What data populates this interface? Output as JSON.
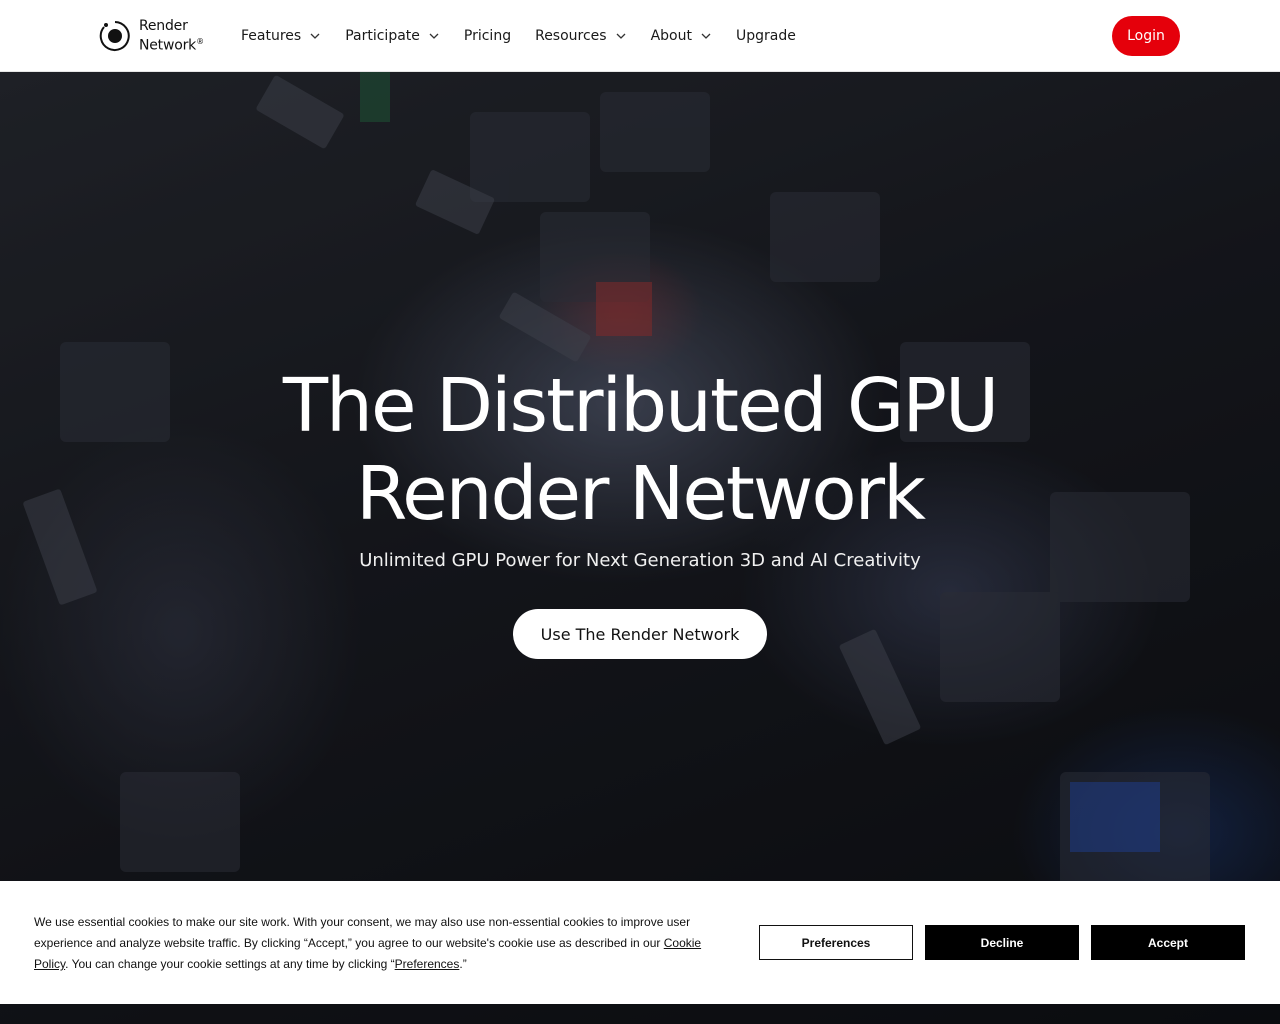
{
  "header": {
    "logo_line1": "Render",
    "logo_line2": "Network",
    "logo_reg": "®",
    "nav": [
      {
        "label": "Features",
        "has_dropdown": true
      },
      {
        "label": "Participate",
        "has_dropdown": true
      },
      {
        "label": "Pricing",
        "has_dropdown": false
      },
      {
        "label": "Resources",
        "has_dropdown": true
      },
      {
        "label": "About",
        "has_dropdown": true
      },
      {
        "label": "Upgrade",
        "has_dropdown": false
      }
    ],
    "login_label": "Login"
  },
  "hero": {
    "title_line1": "The Distributed GPU",
    "title_line2": "Render Network",
    "subtitle": "Unlimited GPU Power for Next Generation 3D and AI Creativity",
    "cta_label": "Use The Render Network"
  },
  "cookie": {
    "text_part1": "We use essential cookies to make our site work. With your consent, we may also use non-essential cookies to improve user experience and analyze website traffic. By clicking “Accept,” you agree to our website's cookie use as described in our ",
    "policy_link": "Cookie Policy",
    "text_part2": ". You can change your cookie settings at any time by clicking “",
    "preferences_link": "Preferences",
    "text_part3": ".”",
    "preferences_label": "Preferences",
    "decline_label": "Decline",
    "accept_label": "Accept"
  },
  "colors": {
    "accent": "#e5000b",
    "header_bg": "#ffffff",
    "button_dark": "#000000"
  }
}
